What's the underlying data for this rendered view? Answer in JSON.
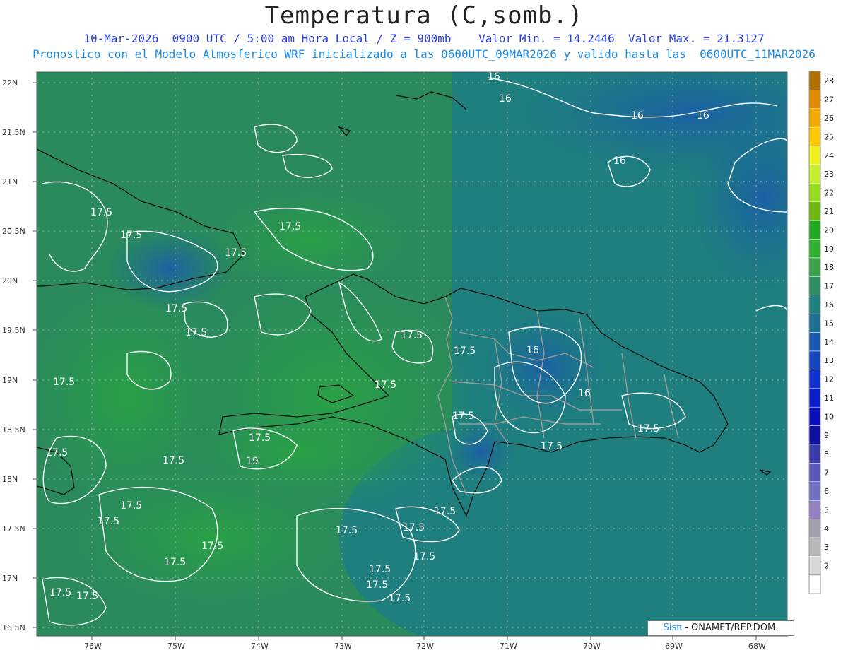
{
  "header": {
    "title": "Temperatura (C,somb.)",
    "line1": "10-Mar-2026  0900 UTC / 5:00 am Hora Local / Z = 900mb    Valor Min. = 14.2446  Valor Max. = 21.3127",
    "line2": "Pronostico con el Modelo Atmosferico WRF inicializado a las 0600UTC_09MAR2026 y valido hasta las  0600UTC_11MAR2026"
  },
  "axes": {
    "lat_labels": [
      "22N",
      "21.5N",
      "21N",
      "20.5N",
      "20N",
      "19.5N",
      "19N",
      "18.5N",
      "18N",
      "17.5N",
      "17N",
      "16.5N"
    ],
    "lon_labels": [
      "76W",
      "75W",
      "74W",
      "73W",
      "72W",
      "71W",
      "70W",
      "69W",
      "68W"
    ]
  },
  "colorbar": {
    "values": [
      28,
      27,
      26,
      25,
      24,
      23,
      22,
      21,
      20,
      19,
      18,
      17,
      16,
      15,
      14,
      13,
      12,
      11,
      10,
      9,
      8,
      7,
      6,
      5,
      4,
      3,
      2
    ],
    "colors": [
      "#b07000",
      "#e08a00",
      "#f0a800",
      "#ffc800",
      "#f0f020",
      "#c8ec30",
      "#98dc20",
      "#6cb810",
      "#20a820",
      "#30b030",
      "#3aa04a",
      "#2e8f62",
      "#208080",
      "#1c7090",
      "#1a58b0",
      "#1446c0",
      "#1030d0",
      "#0a1ecc",
      "#0a10b8",
      "#1010a0",
      "#3a3aa8",
      "#5858b8",
      "#7070c0",
      "#9080c0",
      "#a0a0b0",
      "#b8b8b8",
      "#d8d8d8"
    ]
  },
  "contour_labels": [
    {
      "text": "16"
    },
    {
      "text": "16"
    },
    {
      "text": "16"
    },
    {
      "text": "16"
    },
    {
      "text": "16"
    },
    {
      "text": "16"
    },
    {
      "text": "16"
    },
    {
      "text": "17.5"
    },
    {
      "text": "17.5"
    },
    {
      "text": "17.5"
    },
    {
      "text": "17.5"
    },
    {
      "text": "17.5"
    },
    {
      "text": "17.5"
    },
    {
      "text": "17.5"
    },
    {
      "text": "17.5"
    },
    {
      "text": "17.5"
    },
    {
      "text": "17.5"
    },
    {
      "text": "17.5"
    },
    {
      "text": "17.5"
    },
    {
      "text": "17.5"
    },
    {
      "text": "17.5"
    },
    {
      "text": "17.5"
    },
    {
      "text": "17.5"
    },
    {
      "text": "17.5"
    },
    {
      "text": "17.5"
    },
    {
      "text": "17.5"
    },
    {
      "text": "17.5"
    },
    {
      "text": "17.5"
    },
    {
      "text": "17.5"
    },
    {
      "text": "17.5"
    },
    {
      "text": "17.5"
    },
    {
      "text": "17.5"
    },
    {
      "text": "19"
    }
  ],
  "credit": {
    "sis": "Sisπ",
    "rest": "- ONAMET/REP.DOM."
  }
}
